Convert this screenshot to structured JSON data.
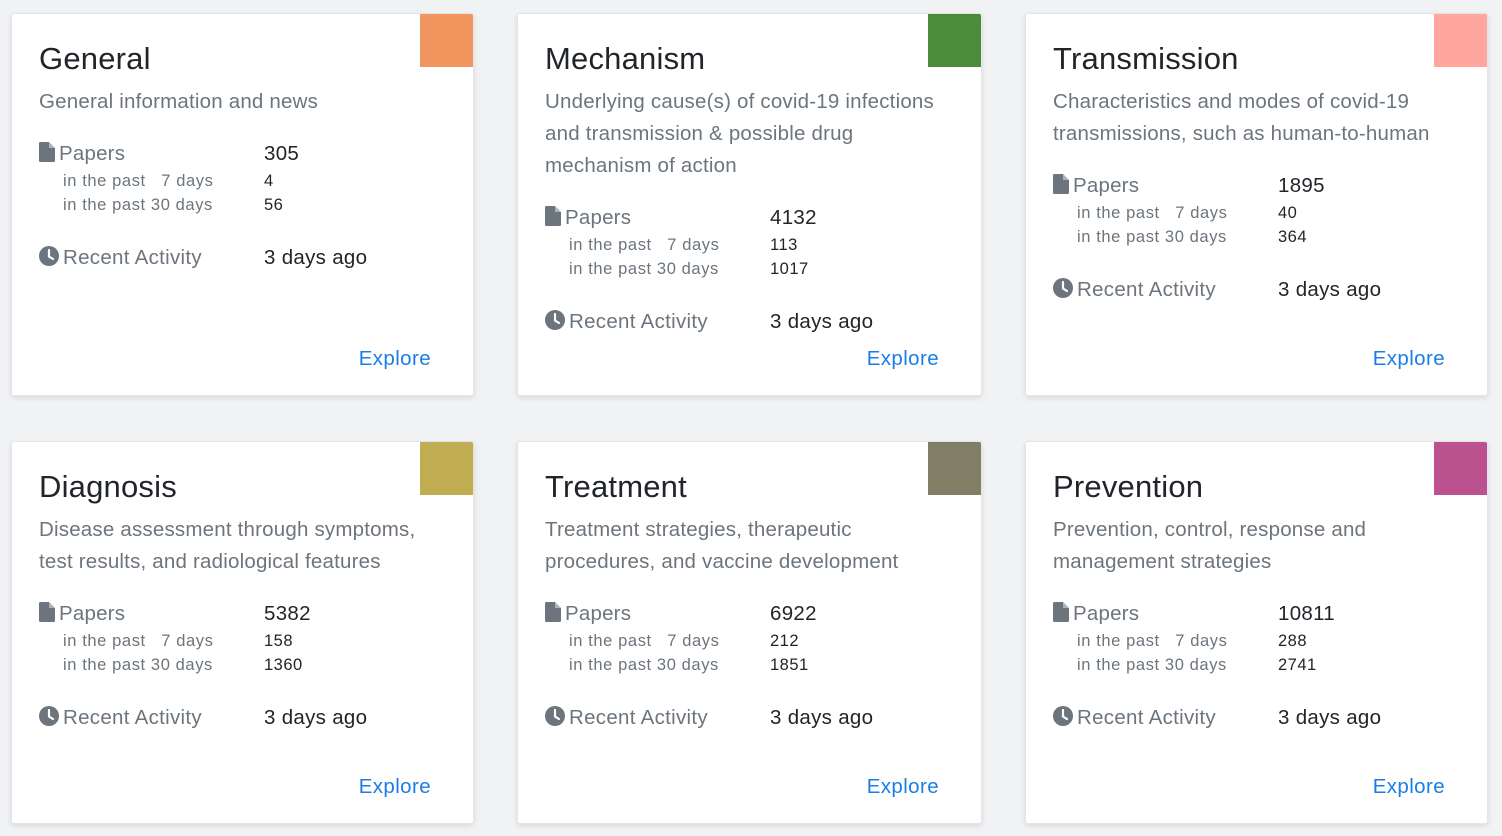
{
  "labels": {
    "papers": "Papers",
    "past7": "in the past   7 days",
    "past30": "in the past 30 days",
    "recent_activity": "Recent Activity",
    "explore": "Explore"
  },
  "categories": [
    {
      "title": "General",
      "description": "General information and news",
      "color": "#f0965e",
      "papers": "305",
      "past7": "4",
      "past30": "56",
      "recent": "3 days ago"
    },
    {
      "title": "Mechanism",
      "description": "Underlying cause(s) of covid-19 infections and transmission & possible drug mechanism of action",
      "color": "#4a8c3a",
      "papers": "4132",
      "past7": "113",
      "past30": "1017",
      "recent": "3 days ago"
    },
    {
      "title": "Transmission",
      "description": "Characteristics and modes of covid-19 transmissions, such as human-to-human",
      "color": "#ffa69e",
      "papers": "1895",
      "past7": "40",
      "past30": "364",
      "recent": "3 days ago"
    },
    {
      "title": "Diagnosis",
      "description": "Disease assessment through symptoms, test results, and radiological features",
      "color": "#c0ad52",
      "papers": "5382",
      "past7": "158",
      "past30": "1360",
      "recent": "3 days ago"
    },
    {
      "title": "Treatment",
      "description": "Treatment strategies, therapeutic procedures, and vaccine development",
      "color": "#817e66",
      "papers": "6922",
      "past7": "212",
      "past30": "1851",
      "recent": "3 days ago"
    },
    {
      "title": "Prevention",
      "description": "Prevention, control, response and management strategies",
      "color": "#bb528f",
      "papers": "10811",
      "past7": "288",
      "past30": "2741",
      "recent": "3 days ago"
    }
  ],
  "icons": {
    "papers": "file-icon",
    "activity": "clock-icon"
  }
}
